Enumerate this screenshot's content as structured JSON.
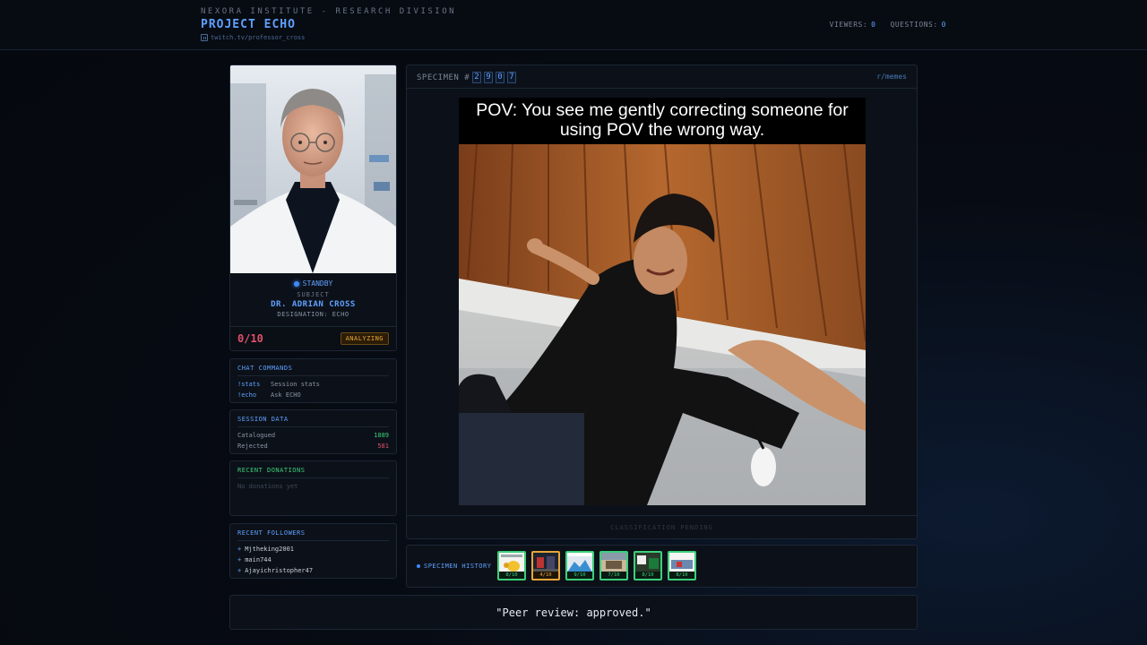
{
  "header": {
    "org": "NEXORA INSTITUTE - RESEARCH DIVISION",
    "title": "PROJECT ECHO",
    "channel_link": "twitch.tv/professor_cross",
    "viewers_label": "VIEWERS:",
    "viewers_value": "0",
    "questions_label": "QUESTIONS:",
    "questions_value": "0"
  },
  "subject": {
    "status": "STANDBY",
    "label": "SUBJECT",
    "name": "DR. ADRIAN CROSS",
    "designation": "DESIGNATION: ECHO",
    "score": "0/10",
    "score_status": "ANALYZING"
  },
  "chat_commands": {
    "title": "CHAT COMMANDS",
    "items": [
      {
        "cmd": "!stats",
        "desc": "Session stats"
      },
      {
        "cmd": "!echo",
        "desc": "Ask ECHO"
      }
    ]
  },
  "session_data": {
    "title": "SESSION DATA",
    "catalogued_label": "Catalogued",
    "catalogued_value": "1889",
    "rejected_label": "Rejected",
    "rejected_value": "581"
  },
  "donations": {
    "title": "RECENT DONATIONS",
    "empty": "No donations yet"
  },
  "followers": {
    "title": "RECENT FOLLOWERS",
    "items": [
      "Mjtheking2001",
      "main744",
      "Ajayichristopher47"
    ]
  },
  "specimen": {
    "label": "SPECIMEN #",
    "digits": [
      "2",
      "9",
      "0",
      "7"
    ],
    "source": "r/memes",
    "caption_line1": "POV: You see me gently correcting someone for",
    "caption_line2": "using POV the wrong way.",
    "classification": "CLASSIFICATION PENDING"
  },
  "history": {
    "label": "SPECIMEN HISTORY",
    "items": [
      {
        "score": "8/10",
        "tone": "green"
      },
      {
        "score": "4/10",
        "tone": "orange"
      },
      {
        "score": "9/10",
        "tone": "green"
      },
      {
        "score": "7/10",
        "tone": "green"
      },
      {
        "score": "8/10",
        "tone": "green"
      },
      {
        "score": "8/10",
        "tone": "green"
      }
    ]
  },
  "quote": "\"Peer review: approved.\"",
  "colors": {
    "accent": "#5fa0ff",
    "positive": "#3ccf7a",
    "negative": "#e0506a",
    "warning": "#e8a53a"
  }
}
